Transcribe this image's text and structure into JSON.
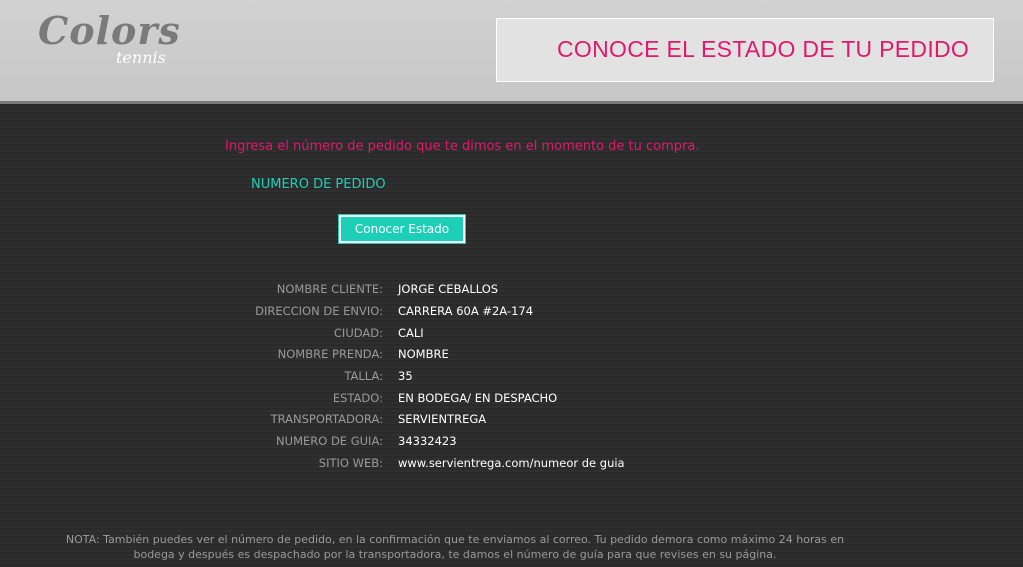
{
  "header": {
    "logo_main": "Colors",
    "logo_sub": "tennis",
    "title": "CONOCE EL ESTADO DE TU PEDIDO"
  },
  "form": {
    "intro": "Ingresa el número de pedido que te dimos en el momento de tu compra.",
    "order_label": "NUMERO DE PEDIDO",
    "button_label": "Conocer Estado"
  },
  "details": [
    {
      "label": "NOMBRE CLIENTE:",
      "value": "JORGE CEBALLOS"
    },
    {
      "label": "DIRECCION DE ENVIO:",
      "value": "CARRERA 60A #2A-174"
    },
    {
      "label": "CIUDAD:",
      "value": "CALI"
    },
    {
      "label": "NOMBRE PRENDA:",
      "value": "NOMBRE"
    },
    {
      "label": "TALLA:",
      "value": "35"
    },
    {
      "label": "ESTADO:",
      "value": "EN BODEGA/ EN DESPACHO"
    },
    {
      "label": "TRANSPORTADORA:",
      "value": "SERVIENTREGA"
    },
    {
      "label": "NUMERO DE GUIA:",
      "value": "34332423"
    },
    {
      "label": "SITIO WEB:",
      "value": "www.servientrega.com/numeor de guia"
    }
  ],
  "note": "NOTA: También puedes ver el número de pedido, en la confirmación que te enviamos al correo. Tu pedido demora como máximo 24 horas en bodega y después es despachado por la transportadora, te damos el número de guía para que revises en su página.",
  "colors": {
    "accent_pink": "#e0196b",
    "accent_teal": "#1ecfb8",
    "background": "#2c2c2c"
  }
}
